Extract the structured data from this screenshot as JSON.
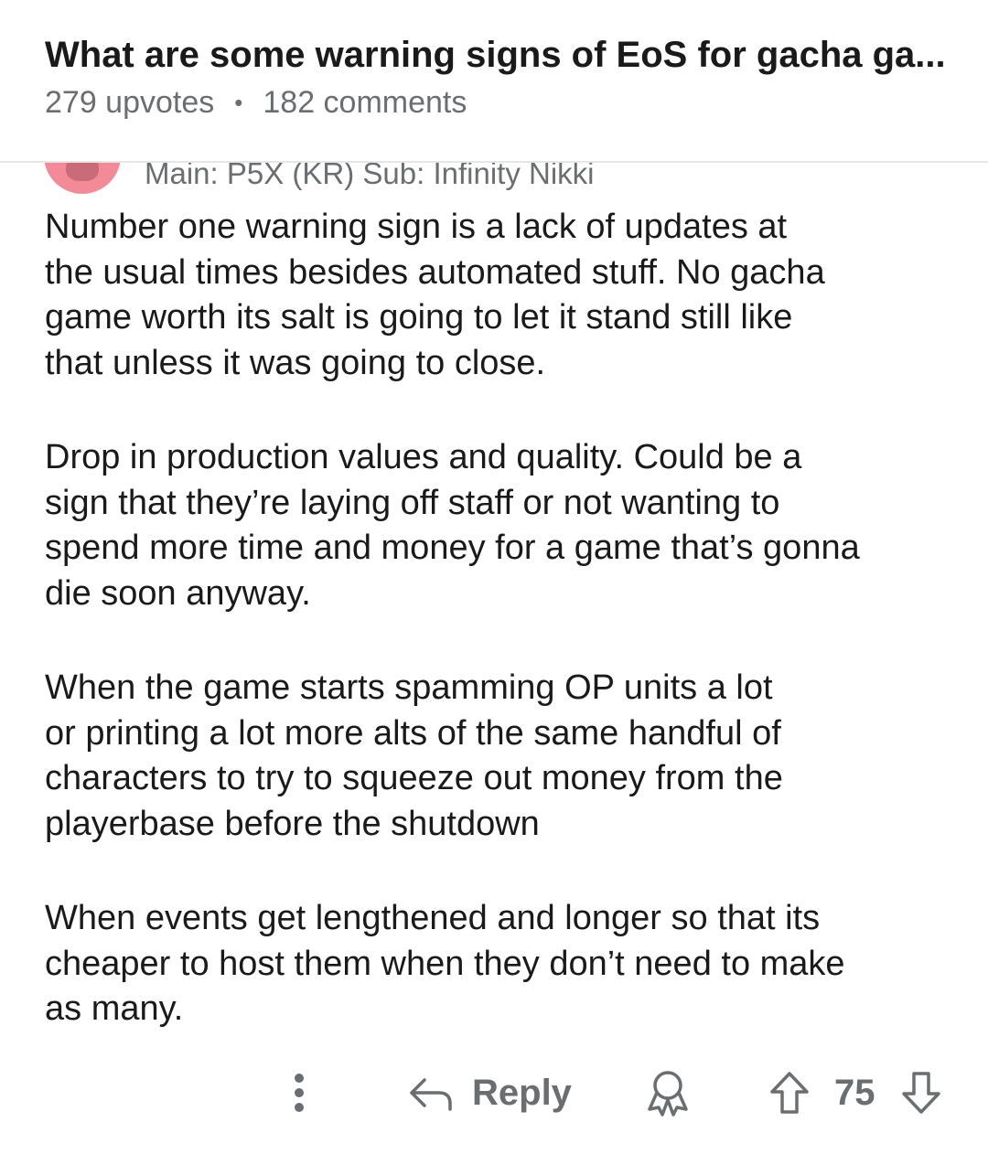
{
  "post": {
    "title": "What are some warning signs of EoS for gacha ga...",
    "upvotes": "279 upvotes",
    "separator": "•",
    "comments": "182 comments"
  },
  "comment": {
    "flair": "Main: P5X (KR) Sub: Infinity Nikki",
    "paragraphs": [
      "Number one warning sign is a lack of updates at\nthe usual times besides automated stuff. No gacha\ngame worth its salt is going to let it stand still like\nthat unless it was going to close.",
      "Drop in production values and quality. Could be a\nsign that they’re laying off staff or not wanting to\nspend more time and money for a game that’s gonna\ndie soon anyway.",
      "When the game starts spamming OP units a lot\nor printing a lot more alts of the same handful of\ncharacters to try to  squeeze out money from the\nplayerbase before the shutdown",
      "When events get lengthened and longer so that its\ncheaper to host them when they don’t need to make\nas many."
    ]
  },
  "actions": {
    "more_icon": "more-vertical-icon",
    "reply_icon": "reply-arrow-icon",
    "reply_label": "Reply",
    "award_icon": "award-icon",
    "upvote_icon": "upvote-arrow-icon",
    "score": "75",
    "downvote_icon": "downvote-arrow-icon"
  },
  "colors": {
    "text": "#1a1a1b",
    "muted": "#6a6e71",
    "avatar": "#f28b97"
  }
}
